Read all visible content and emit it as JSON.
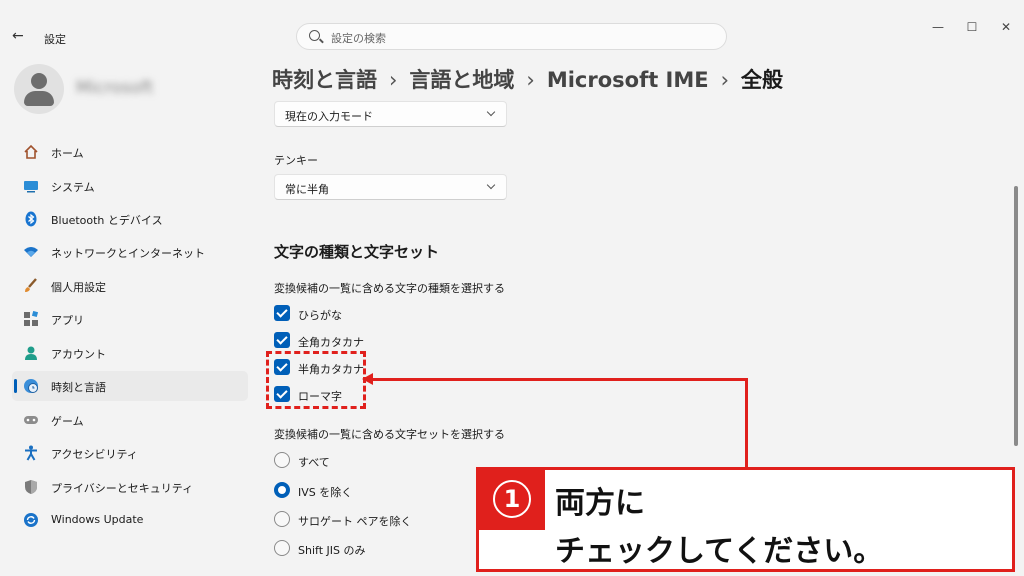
{
  "window": {
    "back_glyph": "←",
    "title": "設定",
    "controls": [
      "—",
      "☐",
      "✕"
    ]
  },
  "search": {
    "placeholder": "設定の検索"
  },
  "profile": {
    "name": "Microsoft"
  },
  "sidebar": {
    "items": [
      {
        "label": "ホーム",
        "icon": "home-icon"
      },
      {
        "label": "システム",
        "icon": "system-icon"
      },
      {
        "label": "Bluetooth とデバイス",
        "icon": "bluetooth-icon"
      },
      {
        "label": "ネットワークとインターネット",
        "icon": "wifi-icon"
      },
      {
        "label": "個人用設定",
        "icon": "brush-icon"
      },
      {
        "label": "アプリ",
        "icon": "apps-icon"
      },
      {
        "label": "アカウント",
        "icon": "account-icon"
      },
      {
        "label": "時刻と言語",
        "icon": "globe-clock-icon",
        "active": true
      },
      {
        "label": "ゲーム",
        "icon": "gamepad-icon"
      },
      {
        "label": "アクセシビリティ",
        "icon": "accessibility-icon"
      },
      {
        "label": "プライバシーとセキュリティ",
        "icon": "shield-icon"
      },
      {
        "label": "Windows Update",
        "icon": "update-icon"
      }
    ]
  },
  "breadcrumb": {
    "items": [
      "時刻と言語",
      "言語と地域",
      "Microsoft IME",
      "全般"
    ],
    "separator": "›"
  },
  "content": {
    "input_mode_dropdown": {
      "value": "現在の入力モード"
    },
    "tenkey": {
      "label": "テンキー",
      "value": "常に半角"
    },
    "section_title": "文字の種類と文字セット",
    "char_types": {
      "label": "変換候補の一覧に含める文字の種類を選択する",
      "options": [
        {
          "label": "ひらがな",
          "checked": true
        },
        {
          "label": "全角カタカナ",
          "checked": true
        },
        {
          "label": "半角カタカナ",
          "checked": true
        },
        {
          "label": "ローマ字",
          "checked": true
        }
      ]
    },
    "char_sets": {
      "label": "変換候補の一覧に含める文字セットを選択する",
      "options": [
        {
          "label": "すべて",
          "selected": false
        },
        {
          "label": "IVS を除く",
          "selected": true
        },
        {
          "label": "サロゲート ペアを除く",
          "selected": false
        },
        {
          "label": "Shift JIS のみ",
          "selected": false
        }
      ]
    }
  },
  "annotation": {
    "number": "1",
    "line1": "両方に",
    "line2": "チェックしてください。",
    "color": "#e0201c"
  },
  "colors": {
    "accent": "#005fb8",
    "background": "#f3f3f3"
  }
}
